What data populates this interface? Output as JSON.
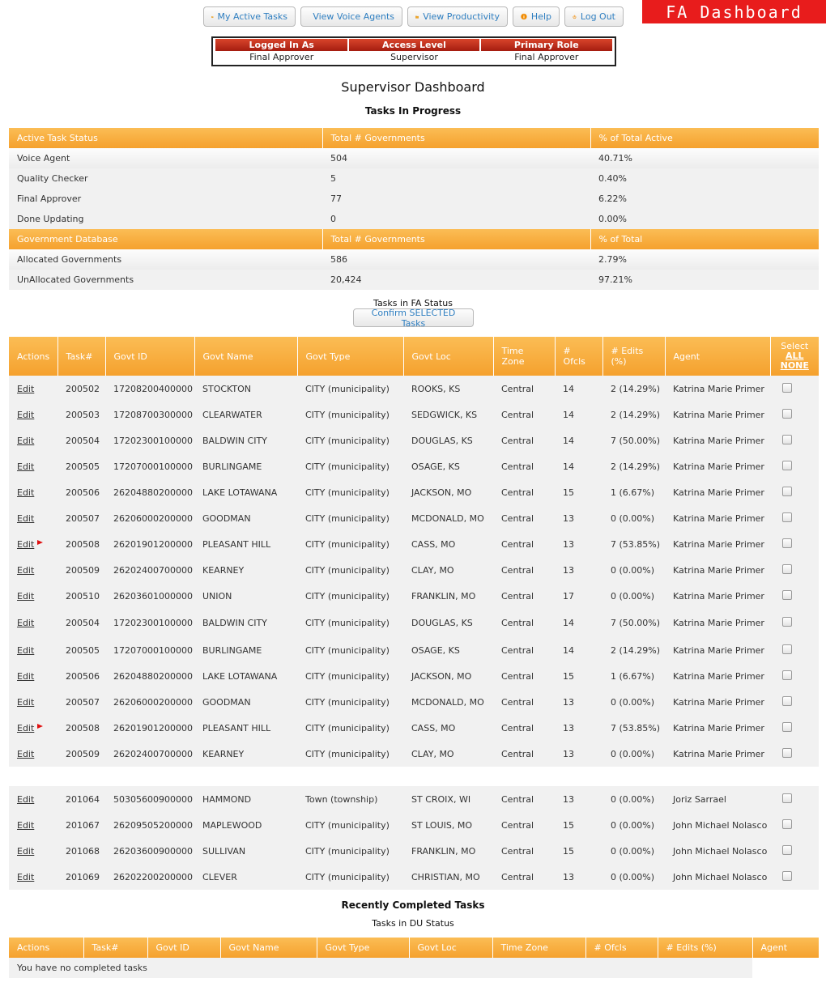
{
  "nav": {
    "my_active_tasks": "My Active Tasks",
    "view_voice_agents": "View Voice Agents",
    "view_productivity": "View Productivity",
    "help": "Help",
    "log_out": "Log Out"
  },
  "brand": "FA Dashboard",
  "user_info": {
    "headers": [
      "Logged In As",
      "Access Level",
      "Primary Role"
    ],
    "values": [
      "Final Approver",
      "Supervisor",
      "Final Approver"
    ]
  },
  "page_title": "Supervisor Dashboard",
  "tasks_in_progress_title": "Tasks In Progress",
  "summary": {
    "active_headers": [
      "Active Task Status",
      "Total # Governments",
      "% of Total Active"
    ],
    "active_rows": [
      [
        "Voice Agent",
        "504",
        "40.71%"
      ],
      [
        "Quality Checker",
        "5",
        "0.40%"
      ],
      [
        "Final Approver",
        "77",
        "6.22%"
      ],
      [
        "Done Updating",
        "0",
        "0.00%"
      ]
    ],
    "db_headers": [
      "Government Database",
      "Total # Governments",
      "% of Total"
    ],
    "db_rows": [
      [
        "Allocated Governments",
        "586",
        "2.79%"
      ],
      [
        "UnAllocated Governments",
        "20,424",
        "97.21%"
      ]
    ]
  },
  "fa_status_title": "Tasks in FA Status",
  "confirm_button": "Confirm SELECTED Tasks",
  "tasks_table": {
    "headers": [
      "Actions",
      "Task#",
      "Govt ID",
      "Govt Name",
      "Govt Type",
      "Govt Loc",
      "Time Zone",
      "# Ofcls",
      "# Edits (%)",
      "Agent"
    ],
    "select_header": {
      "label": "Select",
      "all": "ALL",
      "none": "NONE"
    },
    "edit_label": "Edit",
    "rows": [
      {
        "task": "200502",
        "govt_id": "17208200400000",
        "name": "STOCKTON",
        "type": "CITY (municipality)",
        "loc": "ROOKS, KS",
        "tz": "Central",
        "ofcls": "14",
        "edits": "2 (14.29%)",
        "agent": "Katrina Marie Primer",
        "flag": false
      },
      {
        "task": "200503",
        "govt_id": "17208700300000",
        "name": "CLEARWATER",
        "type": "CITY (municipality)",
        "loc": "SEDGWICK, KS",
        "tz": "Central",
        "ofcls": "14",
        "edits": "2 (14.29%)",
        "agent": "Katrina Marie Primer",
        "flag": false
      },
      {
        "task": "200504",
        "govt_id": "17202300100000",
        "name": "BALDWIN CITY",
        "type": "CITY (municipality)",
        "loc": "DOUGLAS, KS",
        "tz": "Central",
        "ofcls": "14",
        "edits": "7 (50.00%)",
        "agent": "Katrina Marie Primer",
        "flag": false
      },
      {
        "task": "200505",
        "govt_id": "17207000100000",
        "name": "BURLINGAME",
        "type": "CITY (municipality)",
        "loc": "OSAGE, KS",
        "tz": "Central",
        "ofcls": "14",
        "edits": "2 (14.29%)",
        "agent": "Katrina Marie Primer",
        "flag": false
      },
      {
        "task": "200506",
        "govt_id": "26204880200000",
        "name": "LAKE LOTAWANA",
        "type": "CITY (municipality)",
        "loc": "JACKSON, MO",
        "tz": "Central",
        "ofcls": "15",
        "edits": "1 (6.67%)",
        "agent": "Katrina Marie Primer",
        "flag": false
      },
      {
        "task": "200507",
        "govt_id": "26206000200000",
        "name": "GOODMAN",
        "type": "CITY (municipality)",
        "loc": "MCDONALD, MO",
        "tz": "Central",
        "ofcls": "13",
        "edits": "0 (0.00%)",
        "agent": "Katrina Marie Primer",
        "flag": false
      },
      {
        "task": "200508",
        "govt_id": "26201901200000",
        "name": "PLEASANT HILL",
        "type": "CITY (municipality)",
        "loc": "CASS, MO",
        "tz": "Central",
        "ofcls": "13",
        "edits": "7 (53.85%)",
        "agent": "Katrina Marie Primer",
        "flag": true
      },
      {
        "task": "200509",
        "govt_id": "26202400700000",
        "name": "KEARNEY",
        "type": "CITY (municipality)",
        "loc": "CLAY, MO",
        "tz": "Central",
        "ofcls": "13",
        "edits": "0 (0.00%)",
        "agent": "Katrina Marie Primer",
        "flag": false
      },
      {
        "task": "200510",
        "govt_id": "26203601000000",
        "name": "UNION",
        "type": "CITY (municipality)",
        "loc": "FRANKLIN, MO",
        "tz": "Central",
        "ofcls": "17",
        "edits": "0 (0.00%)",
        "agent": "Katrina Marie Primer",
        "flag": false
      },
      {
        "task": "200504",
        "govt_id": "17202300100000",
        "name": "BALDWIN CITY",
        "type": "CITY (municipality)",
        "loc": "DOUGLAS, KS",
        "tz": "Central",
        "ofcls": "14",
        "edits": "7 (50.00%)",
        "agent": "Katrina Marie Primer",
        "flag": false
      },
      {
        "task": "200505",
        "govt_id": "17207000100000",
        "name": "BURLINGAME",
        "type": "CITY (municipality)",
        "loc": "OSAGE, KS",
        "tz": "Central",
        "ofcls": "14",
        "edits": "2 (14.29%)",
        "agent": "Katrina Marie Primer",
        "flag": false
      },
      {
        "task": "200506",
        "govt_id": "26204880200000",
        "name": "LAKE LOTAWANA",
        "type": "CITY (municipality)",
        "loc": "JACKSON, MO",
        "tz": "Central",
        "ofcls": "15",
        "edits": "1 (6.67%)",
        "agent": "Katrina Marie Primer",
        "flag": false
      },
      {
        "task": "200507",
        "govt_id": "26206000200000",
        "name": "GOODMAN",
        "type": "CITY (municipality)",
        "loc": "MCDONALD, MO",
        "tz": "Central",
        "ofcls": "13",
        "edits": "0 (0.00%)",
        "agent": "Katrina Marie Primer",
        "flag": false
      },
      {
        "task": "200508",
        "govt_id": "26201901200000",
        "name": "PLEASANT HILL",
        "type": "CITY (municipality)",
        "loc": "CASS, MO",
        "tz": "Central",
        "ofcls": "13",
        "edits": "7 (53.85%)",
        "agent": "Katrina Marie Primer",
        "flag": true
      },
      {
        "task": "200509",
        "govt_id": "26202400700000",
        "name": "KEARNEY",
        "type": "CITY (municipality)",
        "loc": "CLAY, MO",
        "tz": "Central",
        "ofcls": "13",
        "edits": "0 (0.00%)",
        "agent": "Katrina Marie Primer",
        "flag": false
      },
      {
        "gap": true
      },
      {
        "task": "201064",
        "govt_id": "50305600900000",
        "name": "HAMMOND",
        "type": "Town (township)",
        "loc": "ST CROIX, WI",
        "tz": "Central",
        "ofcls": "13",
        "edits": "0 (0.00%)",
        "agent": "Joriz Sarrael",
        "flag": false
      },
      {
        "task": "201067",
        "govt_id": "26209505200000",
        "name": "MAPLEWOOD",
        "type": "CITY (municipality)",
        "loc": "ST LOUIS, MO",
        "tz": "Central",
        "ofcls": "15",
        "edits": "0 (0.00%)",
        "agent": "John Michael Nolasco",
        "flag": false
      },
      {
        "task": "201068",
        "govt_id": "26203600900000",
        "name": "SULLIVAN",
        "type": "CITY (municipality)",
        "loc": "FRANKLIN, MO",
        "tz": "Central",
        "ofcls": "15",
        "edits": "0 (0.00%)",
        "agent": "John Michael Nolasco",
        "flag": false
      },
      {
        "task": "201069",
        "govt_id": "26202200200000",
        "name": "CLEVER",
        "type": "CITY (municipality)",
        "loc": "CHRISTIAN, MO",
        "tz": "Central",
        "ofcls": "13",
        "edits": "0 (0.00%)",
        "agent": "John Michael Nolasco",
        "flag": false
      }
    ]
  },
  "recently_completed_title": "Recently Completed Tasks",
  "du_status_title": "Tasks in DU Status",
  "completed_table": {
    "headers": [
      "Actions",
      "Task#",
      "Govt ID",
      "Govt Name",
      "Govt Type",
      "Govt Loc",
      "Time Zone",
      "# Ofcls",
      "# Edits (%)",
      "Agent"
    ],
    "empty_message": "You have no completed tasks"
  },
  "colors": {
    "header_orange": "#f5a12e",
    "brand_red": "#e81c1c",
    "link_blue": "#2f7fc1"
  }
}
